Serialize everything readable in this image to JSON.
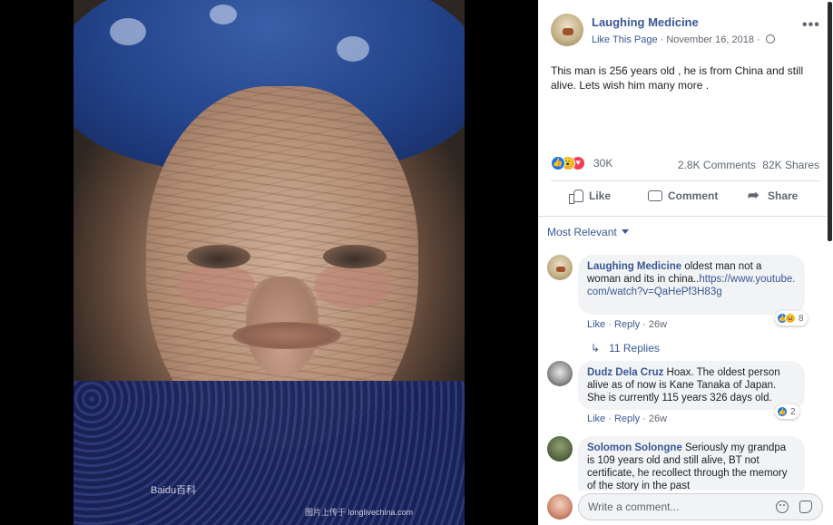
{
  "post": {
    "page_name": "Laughing Medicine",
    "like_page": "Like This Page",
    "separator": " · ",
    "date": "November 16, 2018",
    "separator2": " · ",
    "text": "This man is 256 years old , he is from China and still alive. Lets wish him many more .",
    "more_icon": "more-horizontal-icon",
    "privacy_icon": "globe-icon"
  },
  "photo": {
    "watermark_left": "Baidu百科",
    "watermark_bottom": "图片上传于 longlivechina.com"
  },
  "stats": {
    "reactions_count": "30K",
    "comments": "2.8K Comments",
    "shares": "82K Shares",
    "reaction_icons": [
      "like-reaction-icon",
      "wow-reaction-icon",
      "love-reaction-icon"
    ]
  },
  "actions": {
    "like": "Like",
    "comment": "Comment",
    "share": "Share"
  },
  "sort": {
    "label": "Most Relevant"
  },
  "comments": [
    {
      "author": "Laughing Medicine",
      "text": " oldest man not a woman and its in china..",
      "link": "https://www.youtube.com/watch?v=QaHePf3H83g",
      "like": "Like",
      "dot1": " · ",
      "reply": "Reply",
      "dot2": " · ",
      "time": "26w",
      "reactions": "8"
    },
    {
      "author": "Dudz Dela Cruz",
      "text": " Hoax. The oldest person alive as of now is Kane Tanaka of Japan. She is currently 115 years 326 days old.",
      "like": "Like",
      "dot1": " · ",
      "reply": "Reply",
      "dot2": " · ",
      "time": "26w",
      "reactions": "2"
    },
    {
      "author": "Solomon Solongne",
      "text": " Seriously my grandpa is 109 years old and still alive, BT not certificate, he recollect through the memory of the story in the past"
    }
  ],
  "replies": {
    "label": "11 Replies"
  },
  "composer": {
    "placeholder": "Write a comment..."
  },
  "colors": {
    "link": "#385898",
    "text": "#1c1e21",
    "muted": "#606770",
    "bubble": "#f2f3f5"
  }
}
